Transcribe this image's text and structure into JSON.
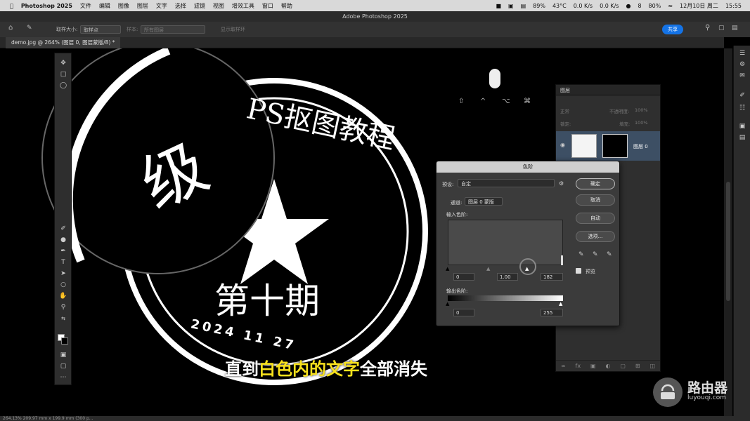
{
  "menubar": {
    "app": "Photoshop 2025",
    "items": [
      "文件",
      "编辑",
      "图像",
      "图层",
      "文字",
      "选择",
      "滤镜",
      "视图",
      "增效工具",
      "窗口",
      "帮助"
    ],
    "status": {
      "cpu": "89%",
      "temp": "43°C",
      "net_up": "0.0 K/s",
      "net_down": "0.0 K/s",
      "badge": "8",
      "battery": "80%",
      "date": "12月10日 周二",
      "time": "15:55"
    }
  },
  "title": "Adobe Photoshop 2025",
  "options": {
    "sample_size_label": "取样大小:",
    "sample_size_value": "取样点",
    "sample_label": "样本:",
    "sample_value": "所有图层",
    "show_ring": "显示取样环",
    "share": "共享"
  },
  "doc_tab": "demo.jpg @ 264% (图层 0, 图层蒙版/8) *",
  "levels": {
    "title": "色阶",
    "preset_label": "预设:",
    "preset_value": "自定",
    "channel_label": "通道:",
    "channel_value": "图层 0 蒙版",
    "input_label": "输入色阶:",
    "input_black": "0",
    "input_gamma": "1.00",
    "input_white": "182",
    "output_label": "输出色阶:",
    "output_black": "0",
    "output_white": "255",
    "ok": "确定",
    "cancel": "取消",
    "auto": "自动",
    "options": "选项...",
    "preview": "预览"
  },
  "layers": {
    "tab": "图层",
    "mode": "正常",
    "opacity_label": "不透明度:",
    "opacity_value": "100%",
    "lock_label": "锁定:",
    "fill_label": "填充:",
    "fill_value": "100%",
    "layer_name": "图层 0"
  },
  "status_bar": "264.13%   209.97 mm x 199.9 mm (300 p...",
  "subtitle": {
    "part1": "直到",
    "highlight": "白色内的文字",
    "part2": "全部消失"
  },
  "watermark": {
    "name": "路由器",
    "url": "luyouqi.com"
  },
  "stamp": {
    "top_text": "PS抠图教程",
    "top_partial": "级",
    "center_text": "第十期",
    "bottom_text": "2024 11 27"
  },
  "colors": {
    "accent": "#1473e6",
    "highlight_yellow": "#f8e21d",
    "selected_layer": "#3d4f64"
  }
}
